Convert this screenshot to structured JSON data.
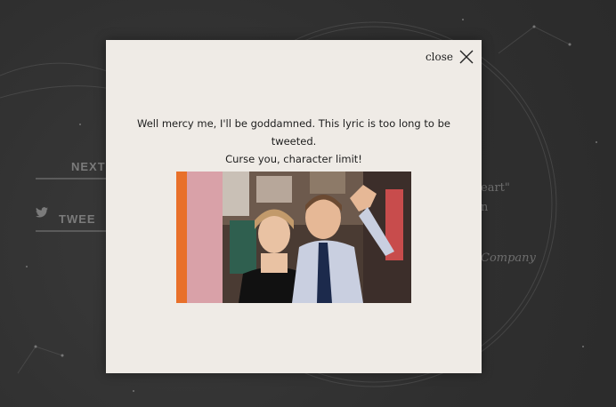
{
  "background": {
    "next_label": "NEXT",
    "tweet_label": "TWEE",
    "song_line1": "eart\"",
    "song_line2": "n",
    "company": "Company"
  },
  "modal": {
    "close_label": "close",
    "message_line1": "Well mercy me, I'll be goddamned. This lyric is too long to be tweeted.",
    "message_line2": "Curse you, character limit!"
  },
  "colors": {
    "page_bg": "#2f2f2f",
    "modal_bg": "#efebe6",
    "text": "#1d1d1d"
  }
}
